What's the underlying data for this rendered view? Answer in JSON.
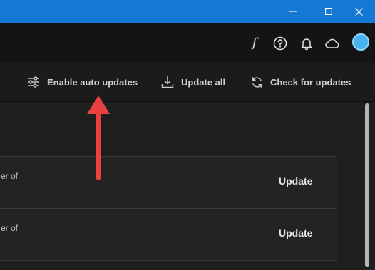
{
  "titlebar": {
    "color": "#1478d4",
    "window_controls": [
      "minimize-icon",
      "maximize-icon",
      "close-icon"
    ]
  },
  "appbar": {
    "icons": [
      "font-icon",
      "help-icon",
      "bell-icon",
      "cloud-icon",
      "avatar"
    ],
    "font_glyph": "f"
  },
  "toolbar": {
    "enable_auto_updates": "Enable auto updates",
    "update_all": "Update all",
    "check_for_updates": "Check for updates"
  },
  "updates": {
    "items": [
      {
        "text_fragment": "er of",
        "button": "Update"
      },
      {
        "text_fragment": "er of",
        "button": "Update"
      }
    ]
  },
  "annotation": {
    "type": "arrow",
    "color": "#e8413f",
    "points_to": "Enable auto updates"
  }
}
